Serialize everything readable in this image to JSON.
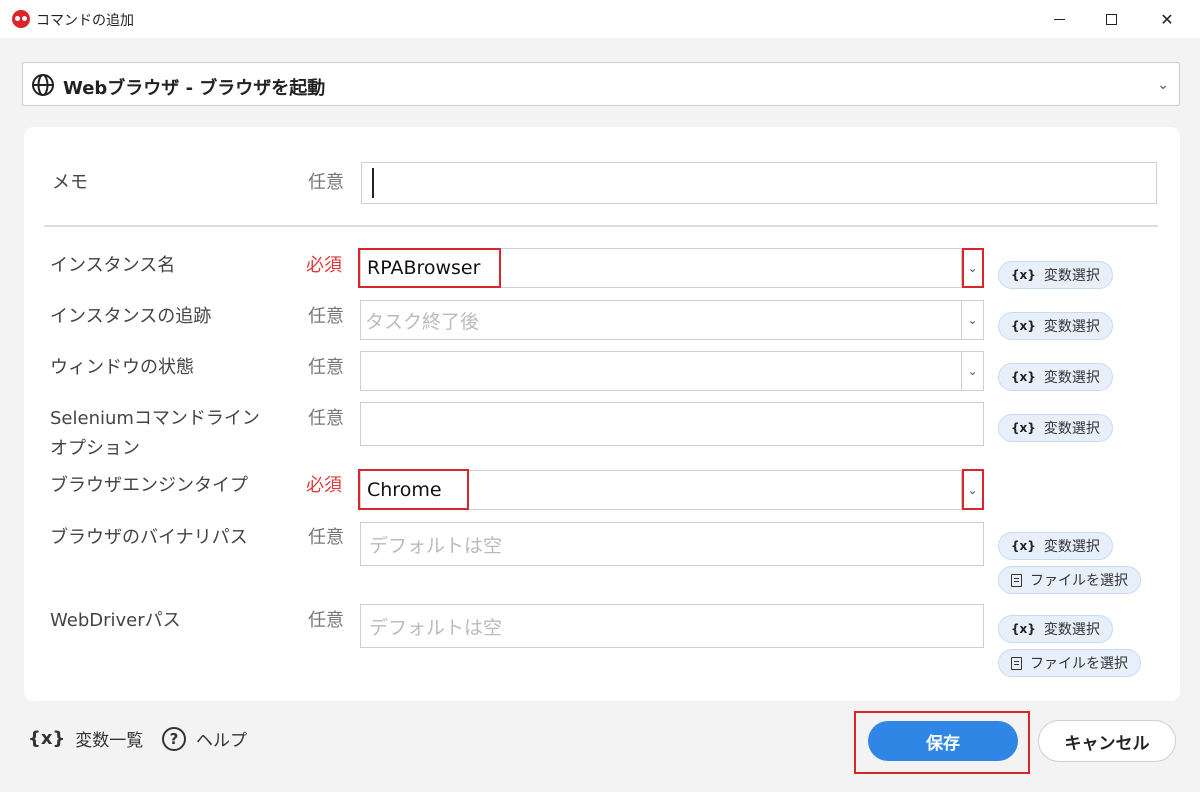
{
  "window": {
    "title": "コマンドの追加",
    "minimize_icon": "minimize-icon",
    "maximize_icon": "maximize-icon",
    "close_label": "✕"
  },
  "command": {
    "icon": "globe-icon",
    "label": "Webブラウザ - ブラウザを起動"
  },
  "memo": {
    "label": "メモ",
    "requirement": "任意",
    "value": ""
  },
  "fields": {
    "instance_name": {
      "label": "インスタンス名",
      "requirement": "必須",
      "value": "RPABrowser"
    },
    "instance_tracking": {
      "label": "インスタンスの追跡",
      "requirement": "任意",
      "placeholder": "タスク終了後"
    },
    "window_state": {
      "label": "ウィンドウの状態",
      "requirement": "任意",
      "value": ""
    },
    "selenium_options": {
      "label_line1": "Seleniumコマンドライン",
      "label_line2": "オプション",
      "requirement": "任意",
      "value": ""
    },
    "browser_engine": {
      "label": "ブラウザエンジンタイプ",
      "requirement": "必須",
      "value": "Chrome"
    },
    "browser_binary": {
      "label": "ブラウザのバイナリパス",
      "requirement": "任意",
      "placeholder": "デフォルトは空"
    },
    "webdriver_path": {
      "label": "WebDriverパス",
      "requirement": "任意",
      "placeholder": "デフォルトは空"
    }
  },
  "chips": {
    "var_mark": "{x}",
    "var_select": "変数選択",
    "file_select": "ファイルを選択"
  },
  "footer": {
    "var_list_mark": "{x}",
    "var_list": "変数一覧",
    "help_mark": "?",
    "help": "ヘルプ",
    "save": "保存",
    "cancel": "キャンセル"
  },
  "colors": {
    "accent": "#2f86e4",
    "required": "#e23a3a",
    "highlight": "#d9262b"
  }
}
